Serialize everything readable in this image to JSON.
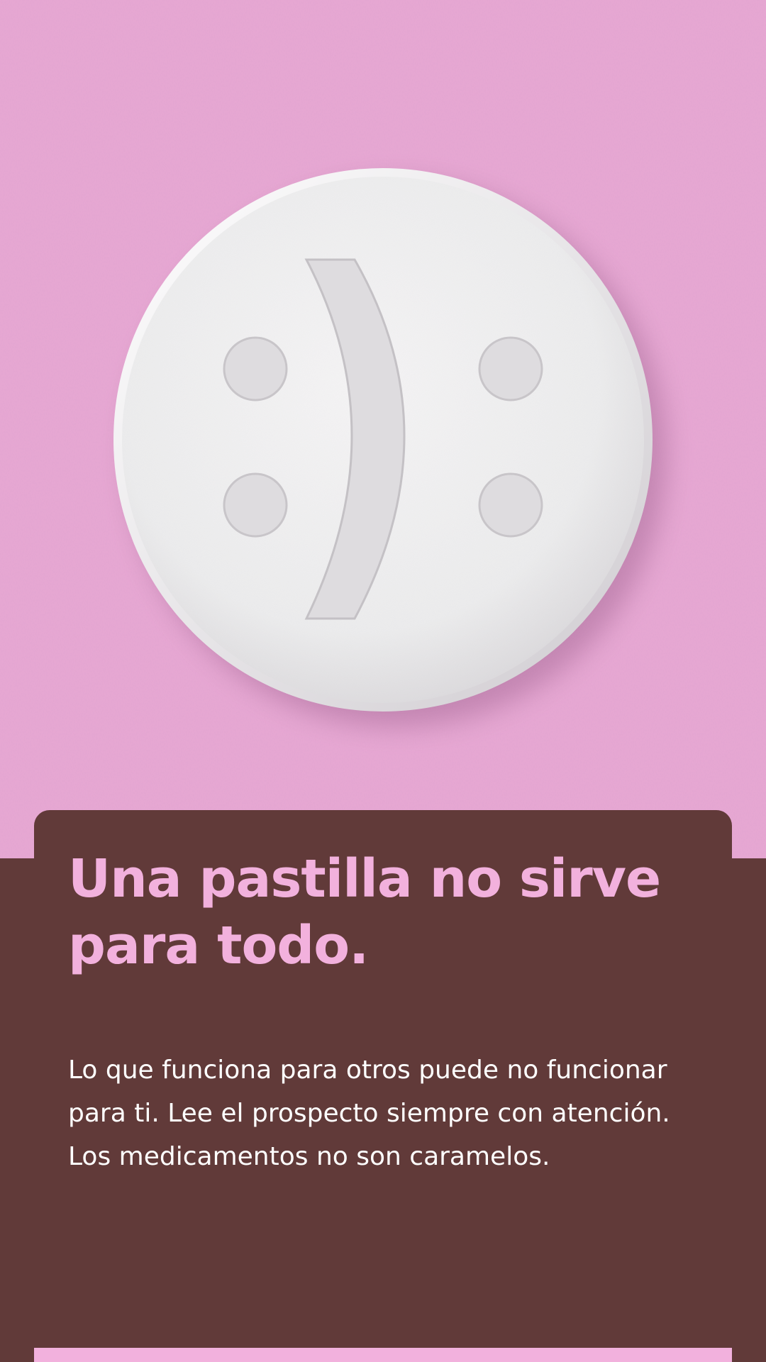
{
  "hero": {
    "background_color": "#e8a8d4",
    "pill_icon": "smiley-pill-icon"
  },
  "content": {
    "headline": "Una pastilla no sirve para todo.",
    "body": "Lo que funciona para otros puede no funcionar para ti. Lee el prospecto siempre con atención. Los medicamentos no son caramelos."
  },
  "colors": {
    "panel": "#613a39",
    "accent_pink": "#f2b1dd",
    "text_white": "#ffffff"
  }
}
